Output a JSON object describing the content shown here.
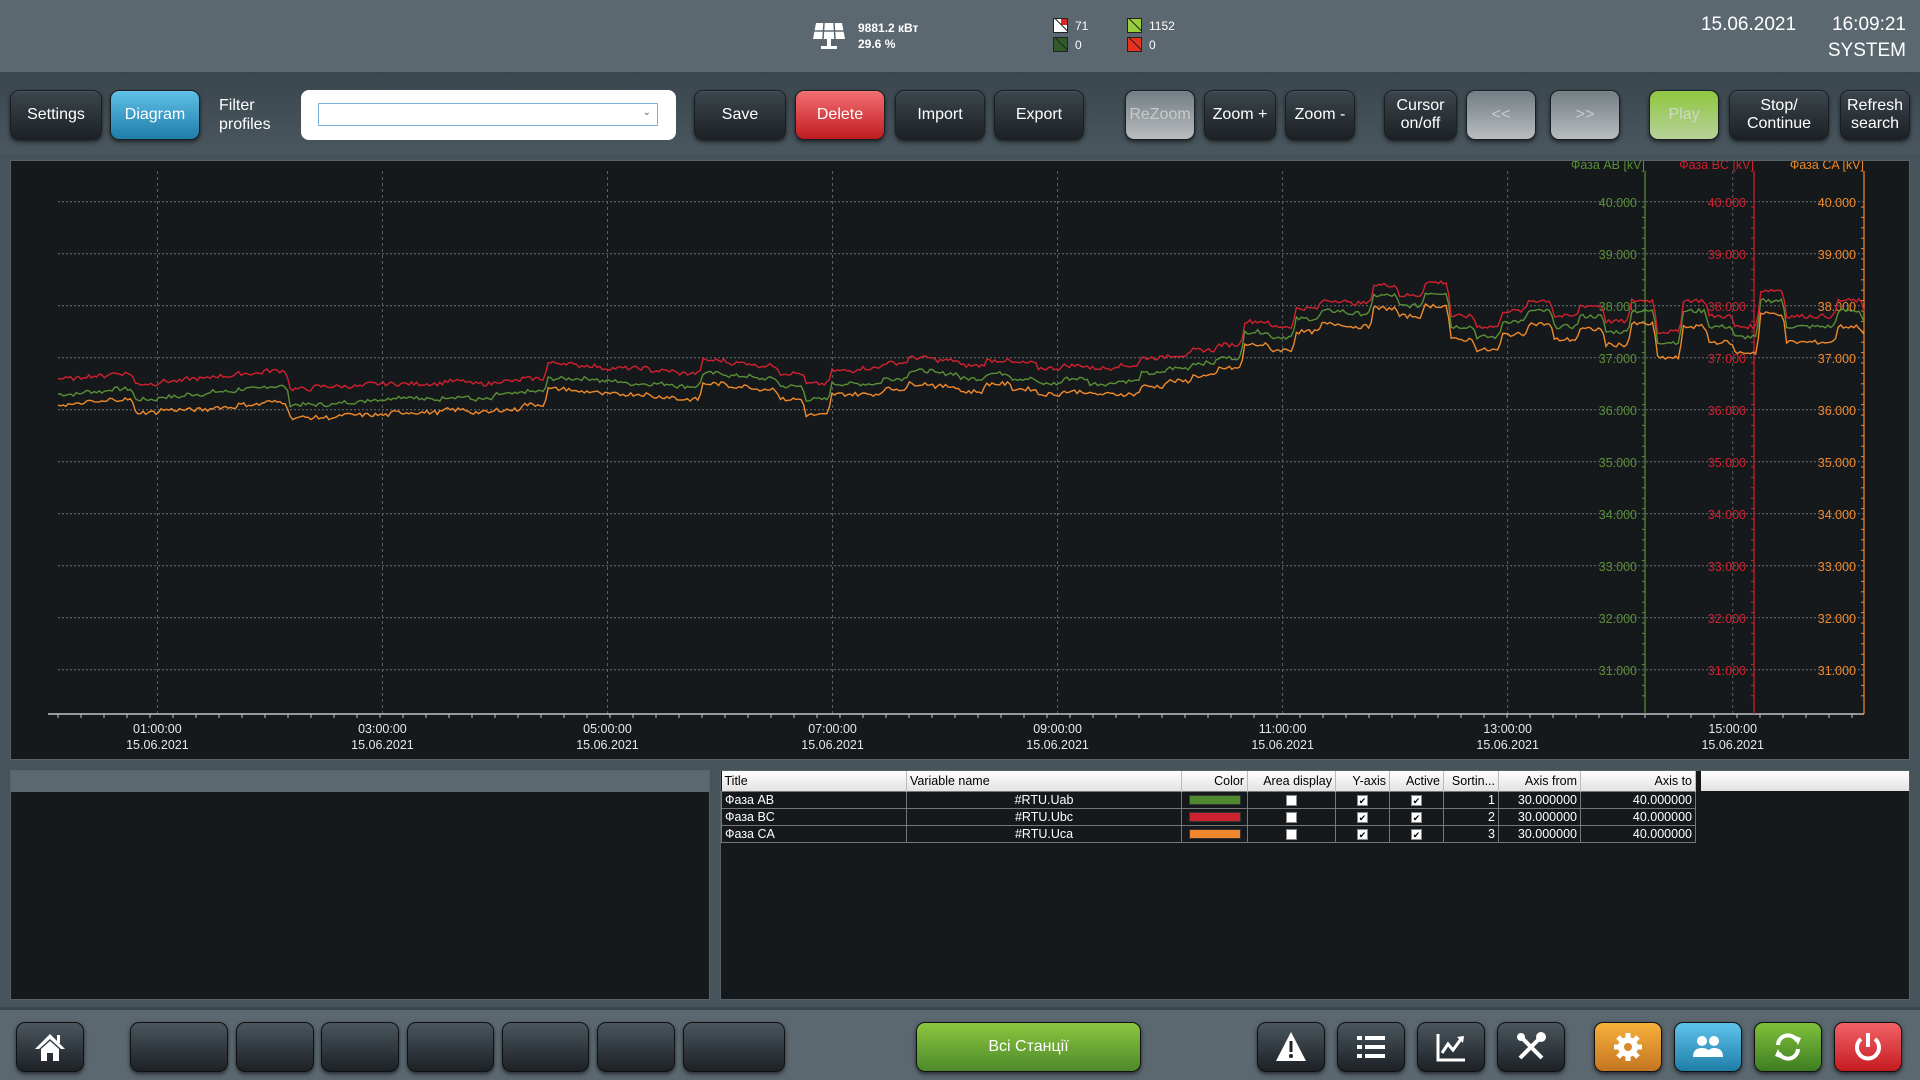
{
  "header": {
    "solar": {
      "power": "9881.2 кВт",
      "percent": "29.6 %"
    },
    "counters": [
      {
        "icon": "alarm-unacknowledged-icon",
        "color": "#ffffff",
        "corner": "#e02020",
        "value": "71"
      },
      {
        "icon": "status-ok-icon",
        "color": "#9acd3c",
        "value": "1152"
      },
      {
        "icon": "status-dark-icon",
        "color": "#2f5a2a",
        "value": "0"
      },
      {
        "icon": "alarm-active-icon",
        "color": "#e8321e",
        "value": "0"
      }
    ],
    "date": "15.06.2021",
    "time": "16:09:21",
    "user": "SYSTEM"
  },
  "toolbar": {
    "settings": "Settings",
    "diagram": "Diagram",
    "filter_label_1": "Filter",
    "filter_label_2": "profiles",
    "filter_value": "",
    "save": "Save",
    "delete": "Delete",
    "import": "Import",
    "export": "Export",
    "rezoom": "ReZoom",
    "zoom_in": "Zoom +",
    "zoom_out": "Zoom -",
    "cursor_1": "Cursor",
    "cursor_2": "on/off",
    "prev": "<<",
    "next": ">>",
    "play": "Play",
    "stop_1": "Stop/",
    "stop_2": "Continue",
    "refresh_1": "Refresh",
    "refresh_2": "search"
  },
  "chart_data": {
    "type": "line",
    "title": "",
    "xlabel": "",
    "x_start": "00:07",
    "x_end": "16:10",
    "x_ticks": [
      {
        "time": "01:00:00",
        "date": "15.06.2021"
      },
      {
        "time": "03:00:00",
        "date": "15.06.2021"
      },
      {
        "time": "05:00:00",
        "date": "15.06.2021"
      },
      {
        "time": "07:00:00",
        "date": "15.06.2021"
      },
      {
        "time": "09:00:00",
        "date": "15.06.2021"
      },
      {
        "time": "11:00:00",
        "date": "15.06.2021"
      },
      {
        "time": "13:00:00",
        "date": "15.06.2021"
      },
      {
        "time": "15:00:00",
        "date": "15.06.2021"
      }
    ],
    "y_ticks": [
      "40.000",
      "39.000",
      "38.000",
      "37.000",
      "36.000",
      "35.000",
      "34.000",
      "33.000",
      "32.000",
      "31.000"
    ],
    "ylim": [
      30.15,
      40.4
    ],
    "grid": true,
    "legend": "top-right",
    "series": [
      {
        "name": "Фаза AB [kV]",
        "color": "#5a8f35",
        "values": [
          36.3,
          36.35,
          36.4,
          36.2,
          36.25,
          36.3,
          36.35,
          36.4,
          36.45,
          36.1,
          36.1,
          36.15,
          36.2,
          36.25,
          36.2,
          36.25,
          36.2,
          36.3,
          36.35,
          36.6,
          36.6,
          36.55,
          36.5,
          36.5,
          36.45,
          36.7,
          36.65,
          36.6,
          36.45,
          36.2,
          36.5,
          36.5,
          36.6,
          36.75,
          36.7,
          36.6,
          36.7,
          36.6,
          36.5,
          36.6,
          36.5,
          36.55,
          36.7,
          36.8,
          36.9,
          37.0,
          37.5,
          37.4,
          37.75,
          37.9,
          37.85,
          38.2,
          38.0,
          38.25,
          37.6,
          37.4,
          37.7,
          37.9,
          37.6,
          37.8,
          37.5,
          37.9,
          37.3,
          37.9,
          37.6,
          37.4,
          38.1,
          37.6,
          37.6,
          37.9,
          37.7
        ]
      },
      {
        "name": "Фаза BC [kV]",
        "color": "#d2202f",
        "values": [
          36.6,
          36.65,
          36.7,
          36.5,
          36.55,
          36.6,
          36.65,
          36.7,
          36.75,
          36.4,
          36.45,
          36.45,
          36.5,
          36.5,
          36.5,
          36.55,
          36.5,
          36.55,
          36.6,
          36.9,
          36.85,
          36.8,
          36.8,
          36.75,
          36.7,
          36.95,
          36.9,
          36.85,
          36.7,
          36.5,
          36.75,
          36.8,
          36.9,
          37.0,
          36.95,
          36.85,
          36.95,
          36.9,
          36.8,
          36.85,
          36.8,
          36.85,
          37.0,
          37.05,
          37.15,
          37.25,
          37.7,
          37.6,
          37.95,
          38.1,
          38.05,
          38.4,
          38.2,
          38.45,
          37.8,
          37.6,
          37.9,
          38.1,
          37.8,
          38.0,
          37.7,
          38.1,
          37.5,
          38.1,
          37.8,
          37.6,
          38.3,
          37.8,
          37.8,
          38.1,
          37.9
        ]
      },
      {
        "name": "Фаза CA [kV]",
        "color": "#f0892a",
        "values": [
          36.1,
          36.15,
          36.2,
          35.95,
          36.0,
          36.0,
          36.05,
          36.1,
          36.15,
          35.85,
          35.85,
          35.9,
          35.9,
          35.95,
          35.95,
          36.0,
          35.95,
          36.0,
          36.1,
          36.4,
          36.35,
          36.3,
          36.3,
          36.25,
          36.2,
          36.5,
          36.45,
          36.4,
          36.2,
          35.9,
          36.3,
          36.3,
          36.4,
          36.5,
          36.45,
          36.35,
          36.5,
          36.4,
          36.3,
          36.35,
          36.3,
          36.3,
          36.45,
          36.55,
          36.65,
          36.8,
          37.25,
          37.15,
          37.5,
          37.65,
          37.6,
          37.95,
          37.8,
          38.0,
          37.35,
          37.15,
          37.45,
          37.65,
          37.35,
          37.55,
          37.25,
          37.65,
          37.0,
          37.6,
          37.3,
          37.1,
          37.85,
          37.3,
          37.3,
          37.6,
          37.45
        ]
      }
    ],
    "cursor_lines": [
      "green",
      "red"
    ]
  },
  "table": {
    "columns": [
      "Title",
      "Variable name",
      "Color",
      "Area display",
      "Y-axis",
      "Active",
      "Sortin...",
      "Axis from",
      "Axis to"
    ],
    "rows": [
      {
        "title": "Фаза AB",
        "variable": "#RTU.Uab",
        "color": "#4f8a2f",
        "area": false,
        "yaxis": true,
        "active": true,
        "sort": "1",
        "from": "30.000000",
        "to": "40.000000"
      },
      {
        "title": "Фаза BC",
        "variable": "#RTU.Ubc",
        "color": "#cc2230",
        "area": false,
        "yaxis": true,
        "active": true,
        "sort": "2",
        "from": "30.000000",
        "to": "40.000000"
      },
      {
        "title": "Фаза CA",
        "variable": "#RTU.Uca",
        "color": "#f0862e",
        "area": false,
        "yaxis": true,
        "active": true,
        "sort": "3",
        "from": "30.000000",
        "to": "40.000000"
      }
    ]
  },
  "footer": {
    "stations": "Всі Станції",
    "icons": [
      "home-icon",
      "alarm-warning-icon",
      "list-icon",
      "trend-chart-icon",
      "tools-icon",
      "settings-gear-icon",
      "users-icon",
      "refresh-icon",
      "power-icon"
    ]
  }
}
